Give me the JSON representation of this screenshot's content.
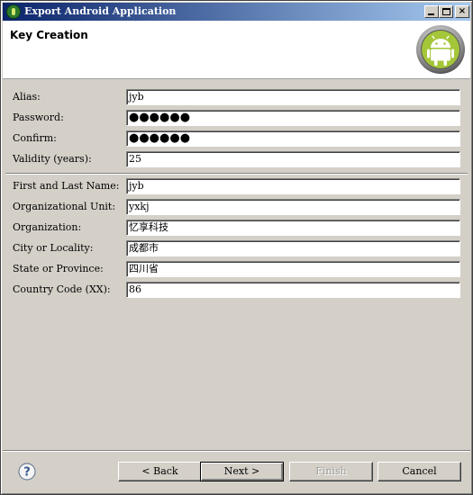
{
  "window": {
    "title": "Export Android Application",
    "controls": {
      "minimize": "_",
      "maximize": "□",
      "close": "×"
    }
  },
  "header": {
    "title": "Key Creation",
    "logo": "android-icon"
  },
  "fields": [
    {
      "label": "Alias:",
      "value": "jyb"
    },
    {
      "label": "Password:",
      "value": "●●●●●●"
    },
    {
      "label": "Confirm:",
      "value": "●●●●●●"
    },
    {
      "label": "Validity (years):",
      "value": "25"
    },
    {
      "label": "First and Last Name:",
      "value": "jyb"
    },
    {
      "label": "Organizational Unit:",
      "value": "yxkj"
    },
    {
      "label": "Organization:",
      "value": "忆享科技"
    },
    {
      "label": "City or Locality:",
      "value": "成都市"
    },
    {
      "label": "State or Province:",
      "value": "四川省"
    },
    {
      "label": "Country Code (XX):",
      "value": "86"
    }
  ],
  "buttons": {
    "back": "< Back",
    "next": "Next >",
    "finish": "Finish",
    "cancel": "Cancel"
  },
  "help": {
    "glyph": "?"
  },
  "colors": {
    "dialog_bg": "#d4d0c8",
    "titlebar_start": "#0a246a",
    "titlebar_end": "#a6caf0",
    "android_green": "#8fc31f"
  }
}
